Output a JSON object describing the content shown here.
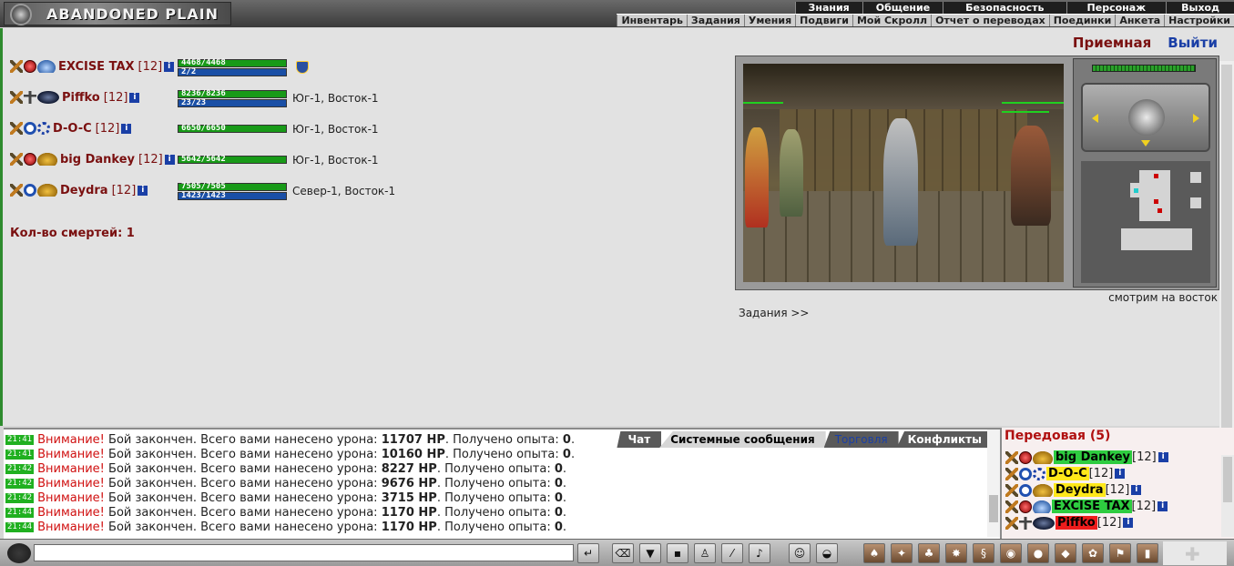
{
  "app": {
    "logo_text": "ABANDONED PLAIN"
  },
  "top_menu": [
    "Знания",
    "Общение",
    "Безопасность",
    "Персонаж",
    "Выход"
  ],
  "sub_menu": [
    "Инвентарь",
    "Задания",
    "Умения",
    "Подвиги",
    "Мой Скролл",
    "Отчет о переводах",
    "Поединки",
    "Анкета",
    "Настройки"
  ],
  "links": {
    "reception": "Приемная",
    "exit": "Выйти"
  },
  "party": [
    {
      "name": "EXCISE TAX",
      "level": "[12]",
      "hp": "4468/4468",
      "mp": "2/2",
      "location": "",
      "icons": [
        "sword-icon",
        "red-orb-icon",
        "blue-wing-icon"
      ]
    },
    {
      "name": "Piffko",
      "level": "[12]",
      "hp": "8236/8236",
      "mp": "23/23",
      "location": "Юг-1, Восток-1",
      "icons": [
        "sword-icon",
        "cross-icon",
        "eye-icon"
      ]
    },
    {
      "name": "D-O-C",
      "level": "[12]",
      "hp": "6650/6650",
      "mp": "",
      "location": "Юг-1, Восток-1",
      "icons": [
        "sword-icon",
        "blue-orb-icon",
        "gear-icon"
      ]
    },
    {
      "name": "big Dankey",
      "level": "[12]",
      "hp": "5642/5642",
      "mp": "",
      "location": "Юг-1, Восток-1",
      "icons": [
        "sword-icon",
        "red-orb-icon",
        "gold-wing-icon"
      ]
    },
    {
      "name": "Deydra",
      "level": "[12]",
      "hp": "7505/7505",
      "mp": "1423/1423",
      "location": "Север-1, Восток-1",
      "icons": [
        "sword-icon",
        "blue-orb-icon",
        "gold-wing-icon"
      ]
    }
  ],
  "deaths": "Кол-во смертей: 1",
  "game": {
    "watching": "смотрим на восток",
    "tasks_link": "Задания >>"
  },
  "chat": {
    "tabs": [
      "Чат",
      "Системные сообщения",
      "Торговля",
      "Конфликты"
    ],
    "active_tab": "Системные сообщения",
    "lines": [
      {
        "time": "21:41",
        "warn": "Внимание!",
        "text": "Бой закончен. Всего вами нанесено урона:",
        "damage": "11707 HP",
        "exp_text": "Получено опыта:",
        "exp": "0"
      },
      {
        "time": "21:41",
        "warn": "Внимание!",
        "text": "Бой закончен. Всего вами нанесено урона:",
        "damage": "10160 HP",
        "exp_text": "Получено опыта:",
        "exp": "0"
      },
      {
        "time": "21:42",
        "warn": "Внимание!",
        "text": "Бой закончен. Всего вами нанесено урона:",
        "damage": "8227 HP",
        "exp_text": "Получено опыта:",
        "exp": "0"
      },
      {
        "time": "21:42",
        "warn": "Внимание!",
        "text": "Бой закончен. Всего вами нанесено урона:",
        "damage": "9676 HP",
        "exp_text": "Получено опыта:",
        "exp": "0"
      },
      {
        "time": "21:42",
        "warn": "Внимание!",
        "text": "Бой закончен. Всего вами нанесено урона:",
        "damage": "3715 HP",
        "exp_text": "Получено опыта:",
        "exp": "0"
      },
      {
        "time": "21:44",
        "warn": "Внимание!",
        "text": "Бой закончен. Всего вами нанесено урона:",
        "damage": "1170 HP",
        "exp_text": "Получено опыта:",
        "exp": "0"
      },
      {
        "time": "21:44",
        "warn": "Внимание!",
        "text": "Бой закончен. Всего вами нанесено урона:",
        "damage": "1170 HP",
        "exp_text": "Получено опыта:",
        "exp": "0"
      }
    ]
  },
  "players_list": {
    "title": "Передовая (5)",
    "players": [
      {
        "name": "big Dankey",
        "level": "[12]",
        "highlight": "#2ecc40"
      },
      {
        "name": "D-O-C",
        "level": "[12]",
        "highlight": "#ffe81a"
      },
      {
        "name": "Deydra",
        "level": "[12]",
        "highlight": "#ffe81a"
      },
      {
        "name": "EXCISE TAX",
        "level": "[12]",
        "highlight": "#2ecc40"
      },
      {
        "name": "Piffko",
        "level": "[12]",
        "highlight": "#ee1c1c"
      }
    ]
  },
  "toolbar": {
    "chat_input_value": ""
  }
}
